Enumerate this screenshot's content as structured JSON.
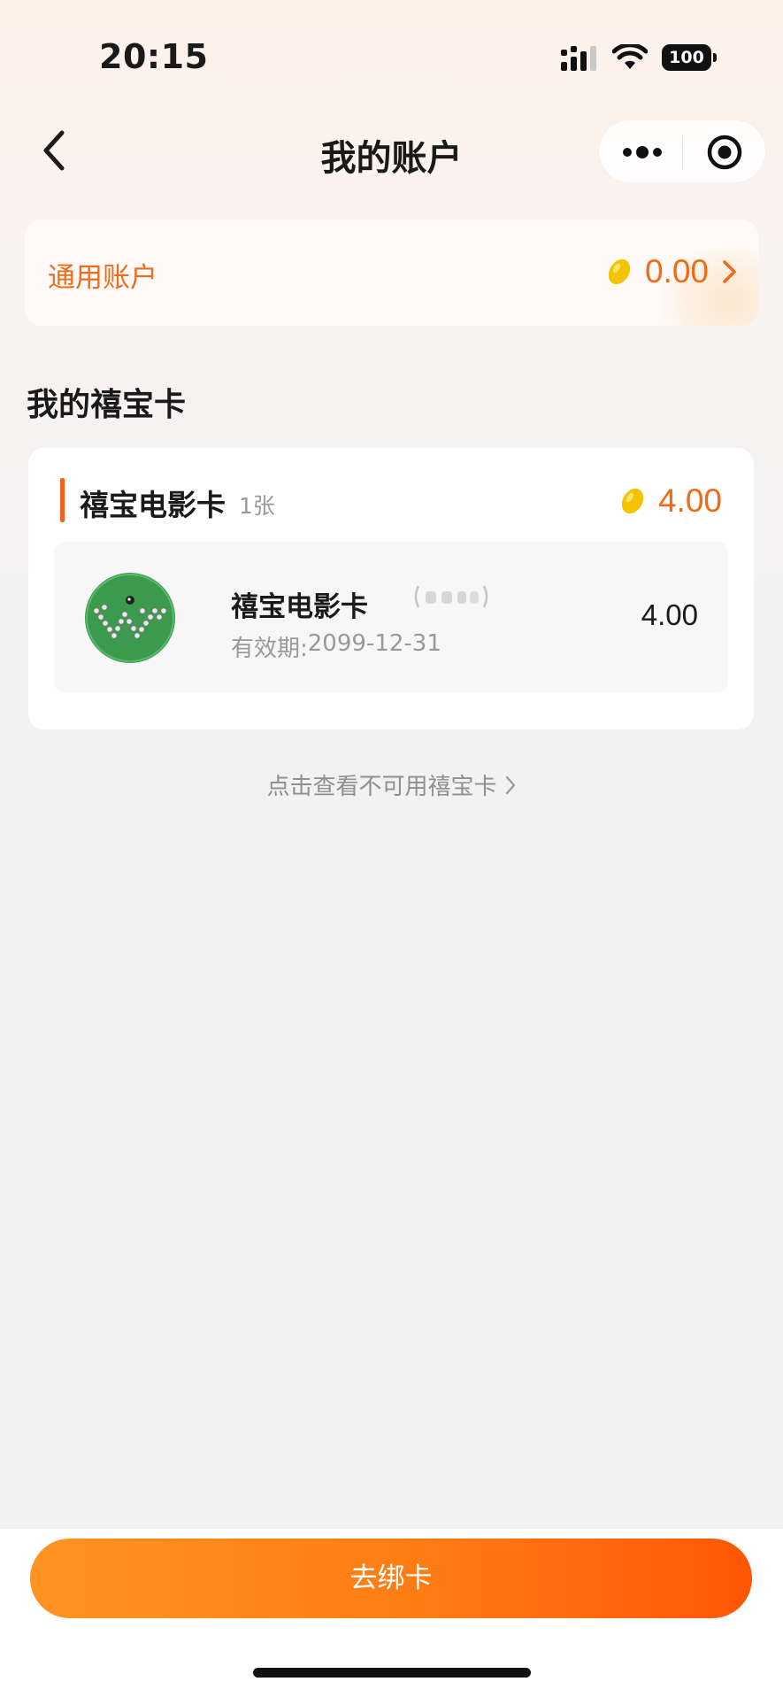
{
  "status_bar": {
    "time": "20:15",
    "battery": "100",
    "icons": [
      "signal-icon",
      "wifi-icon",
      "battery-icon"
    ]
  },
  "nav": {
    "title": "我的账户",
    "back_icon": "chevron-left-icon",
    "capsule_icons": [
      "more-dots-icon",
      "close-target-icon"
    ]
  },
  "general_account": {
    "label": "通用账户",
    "amount": "0.00",
    "icon": "bean-coin-icon"
  },
  "section": {
    "title": "我的禧宝卡"
  },
  "card_group": {
    "name": "禧宝电影卡",
    "count": "1张",
    "total": "4.00",
    "cards": [
      {
        "name": "禧宝电影卡",
        "expiry_label": "有效期:",
        "expiry": "2099-12-31",
        "value": "4.00",
        "logo": "w-logo-icon"
      }
    ]
  },
  "links": {
    "view_unavailable": "点击查看不可用禧宝卡"
  },
  "bottom": {
    "bind_button": "去绑卡"
  },
  "colors": {
    "accent": "#f26a14",
    "button_start": "#ff9422",
    "button_end": "#ff5603",
    "logo_green": "#3c9a4e"
  }
}
